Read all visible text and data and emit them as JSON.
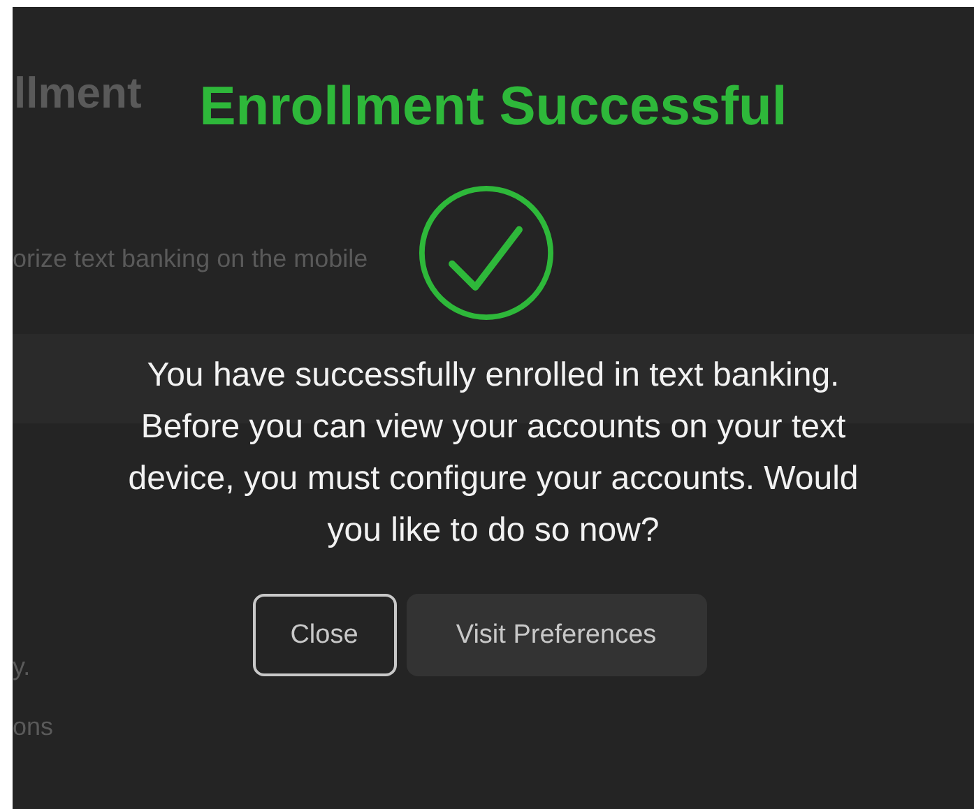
{
  "background_page": {
    "heading": "llment",
    "instruction": "orize text banking on the mobile",
    "line_1": "y.",
    "line_2": "ons"
  },
  "dialog": {
    "title": "Enrollment Successful",
    "message": "You have successfully enrolled in text banking. Before you can view your accounts on your text device, you must configure your accounts. Would you like to do so now?",
    "buttons": [
      {
        "label": "Close",
        "kind": "outline"
      },
      {
        "label": "Visit Preferences",
        "kind": "filled"
      }
    ]
  }
}
